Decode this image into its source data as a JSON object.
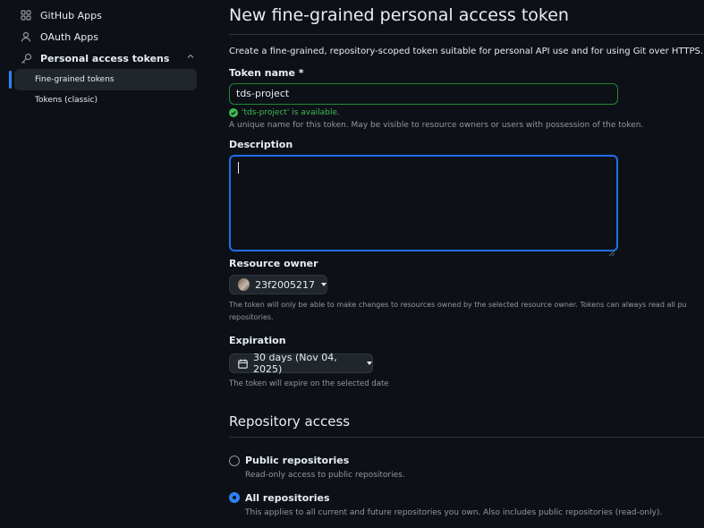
{
  "sidebar": {
    "github_apps": "GitHub Apps",
    "oauth_apps": "OAuth Apps",
    "pat": "Personal access tokens",
    "fine_grained": "Fine-grained tokens",
    "classic": "Tokens (classic)"
  },
  "page": {
    "title": "New fine-grained personal access token",
    "intro": "Create a fine-grained, repository-scoped token suitable for personal API use and for using Git over HTTPS."
  },
  "token_name": {
    "label": "Token name *",
    "value": "tds-project",
    "available_msg": "'tds-project' is available.",
    "hint": "A unique name for this token. May be visible to resource owners or users with possession of the token."
  },
  "description": {
    "label": "Description",
    "value": ""
  },
  "resource_owner": {
    "label": "Resource owner",
    "value": "23f2005217",
    "hint_line1": "The token will only be able to make changes to resources owned by the selected resource owner. Tokens can always read all pu",
    "hint_line2": "repositories."
  },
  "expiration": {
    "label": "Expiration",
    "value": "30 days (Nov 04, 2025)",
    "hint": "The token will expire on the selected date"
  },
  "repo_access": {
    "title": "Repository access",
    "options": [
      {
        "label": "Public repositories",
        "desc": "Read-only access to public repositories.",
        "selected": false
      },
      {
        "label": "All repositories",
        "desc": "This applies to all current and future repositories you own. Also includes public repositories (read-only).",
        "selected": true
      }
    ]
  },
  "colors": {
    "accent": "#2f81f7",
    "success": "#3fb950",
    "background": "#0d1117"
  }
}
